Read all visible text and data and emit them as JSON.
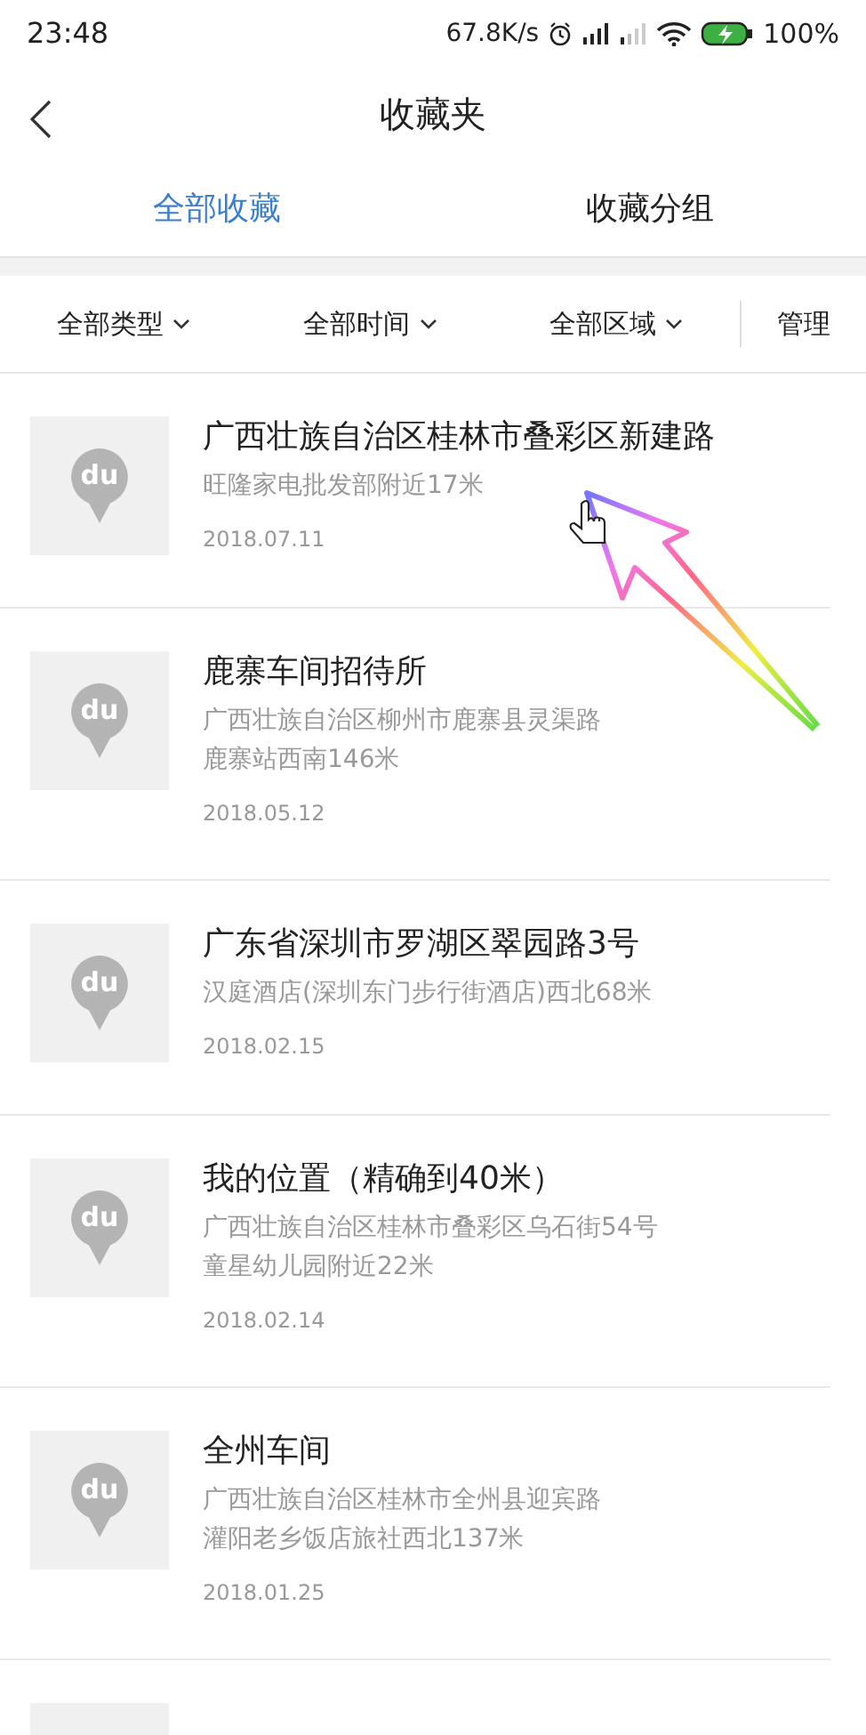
{
  "status_bar": {
    "time": "23:48",
    "speed": "67.8K/s",
    "battery": "100%"
  },
  "header": {
    "title": "收藏夹"
  },
  "tabs": [
    {
      "label": "全部收藏",
      "selected": true
    },
    {
      "label": "收藏分组",
      "selected": false
    }
  ],
  "filters": [
    {
      "label": "全部类型"
    },
    {
      "label": "全部时间"
    },
    {
      "label": "全部区域"
    }
  ],
  "manage": "管理",
  "items": [
    {
      "thumb_text": "du",
      "title": "广西壮族自治区桂林市叠彩区新建路",
      "lines": [
        "旺隆家电批发部附近17米"
      ],
      "date": "2018.07.11"
    },
    {
      "thumb_text": "du",
      "title": "鹿寨车间招待所",
      "lines": [
        "广西壮族自治区柳州市鹿寨县灵渠路",
        "鹿寨站西南146米"
      ],
      "date": "2018.05.12"
    },
    {
      "thumb_text": "du",
      "title": "广东省深圳市罗湖区翠园路3号",
      "lines": [
        "汉庭酒店(深圳东门步行街酒店)西北68米"
      ],
      "date": "2018.02.15"
    },
    {
      "thumb_text": "du",
      "title": "我的位置（精确到40米）",
      "lines": [
        "广西壮族自治区桂林市叠彩区乌石街54号",
        "童星幼儿园附近22米"
      ],
      "date": "2018.02.14"
    },
    {
      "thumb_text": "du",
      "title": "全州车间",
      "lines": [
        "广西壮族自治区桂林市全州县迎宾路",
        "灌阳老乡饭店旅社西北137米"
      ],
      "date": "2018.01.25"
    }
  ],
  "next_item_cut_off": true
}
